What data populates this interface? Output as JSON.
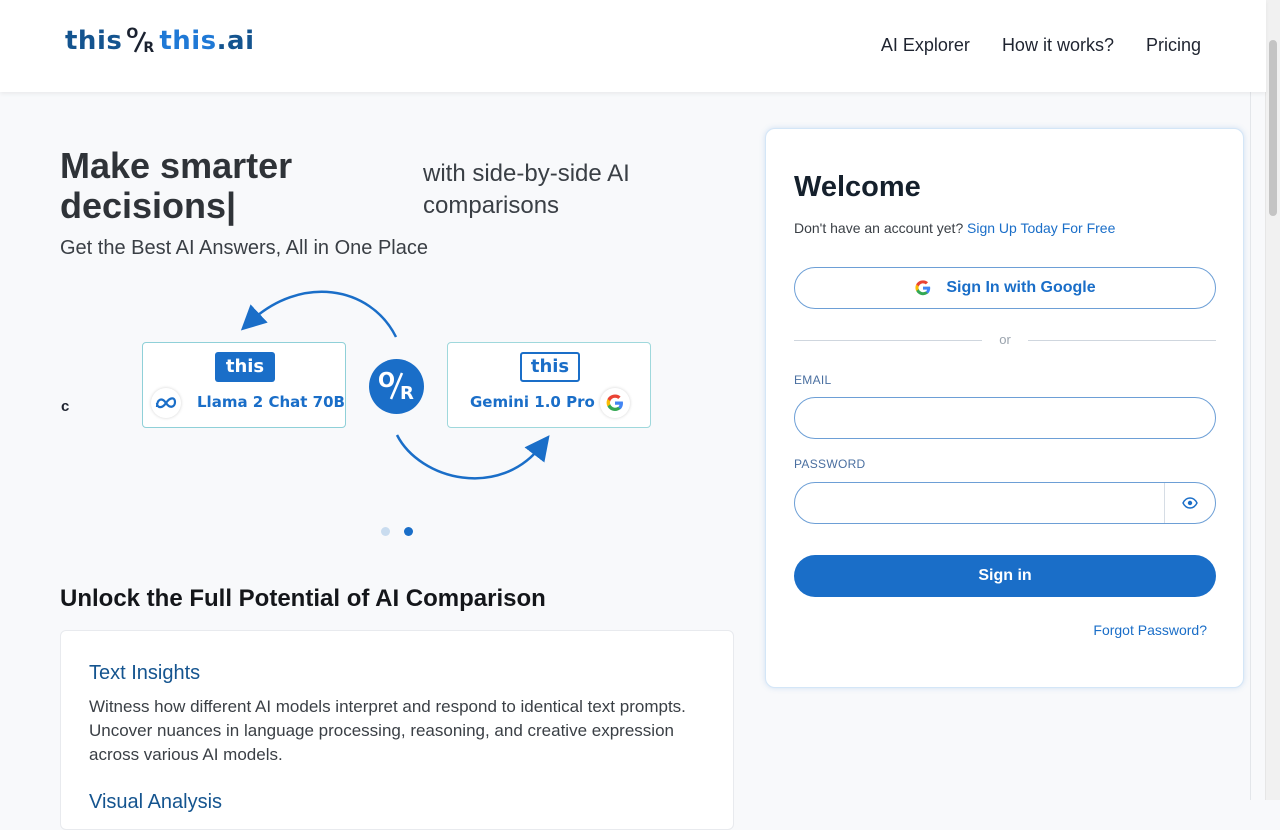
{
  "header": {
    "logo": {
      "part1": "this",
      "or_o": "O",
      "or_r": "R",
      "part2": "this",
      "suffix": ".ai"
    },
    "nav": [
      {
        "label": "AI Explorer"
      },
      {
        "label": "How it works?"
      },
      {
        "label": "Pricing"
      }
    ]
  },
  "hero": {
    "title": "Make smarter decisions|",
    "subtitle": "with side-by-side AI comparisons",
    "tagline": "Get the Best AI Answers, All in One Place",
    "stray_char": "c",
    "left_card": {
      "pill": "this",
      "model": "Llama 2 Chat 70B",
      "icon": "meta-icon"
    },
    "right_card": {
      "pill": "this",
      "model": "Gemini 1.0 Pro",
      "icon": "google-icon"
    },
    "or_badge": {
      "o": "O",
      "r": "R"
    },
    "carousel_active_index": 1
  },
  "features": {
    "section_title": "Unlock the Full Potential of AI Comparison",
    "items": [
      {
        "title": "Text Insights",
        "text": "Witness how different AI models interpret and respond to identical text prompts. Uncover nuances in language processing, reasoning, and creative expression across various AI models."
      },
      {
        "title": "Visual Analysis"
      }
    ]
  },
  "login": {
    "title": "Welcome",
    "no_account": "Don't have an account yet?",
    "signup_link": "Sign Up Today For Free",
    "google_button": "Sign In with Google",
    "divider": "or",
    "email_label": "EMAIL",
    "email_value": "",
    "password_label": "PASSWORD",
    "password_value": "",
    "signin_button": "Sign in",
    "forgot_link": "Forgot Password?"
  },
  "colors": {
    "accent": "#1a6ec8",
    "dark_blue": "#14548f"
  }
}
